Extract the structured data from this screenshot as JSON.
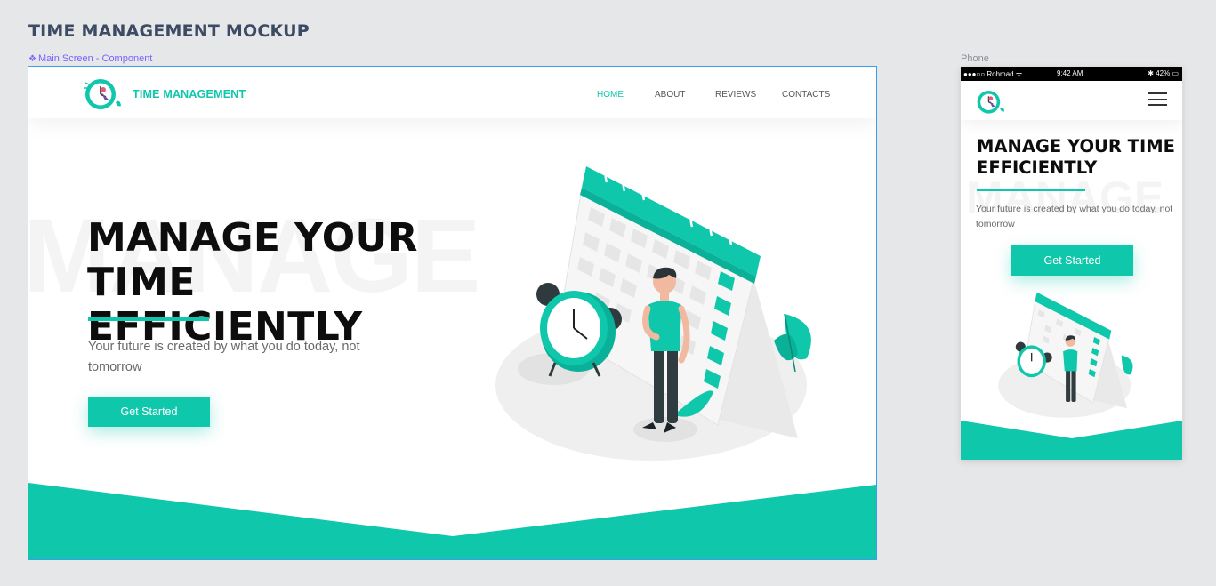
{
  "page": {
    "title": "TIME MANAGEMENT MOCKUP",
    "frame_label": "Main Screen  - Component",
    "phone_label": "Phone"
  },
  "colors": {
    "accent": "#0fc7ab",
    "frame_selection": "#3c9cf0",
    "text_dark": "#0d0d0d",
    "text_muted": "#6a6a6a"
  },
  "desktop": {
    "brand": "TIME MANAGEMENT",
    "nav": [
      {
        "label": "HOME",
        "active": true
      },
      {
        "label": "ABOUT",
        "active": false
      },
      {
        "label": "REVIEWS",
        "active": false
      },
      {
        "label": "CONTACTS",
        "active": false
      }
    ],
    "watermark": "MANAGE",
    "headline_line1": "MANAGE YOUR TIME",
    "headline_line2": "EFFICIENTLY",
    "subtitle": "Your future is created by what you do today, not tomorrow",
    "cta": "Get Started",
    "icons": {
      "logo": "clock-logo-icon",
      "illustration": "calendar-clock-person-illustration"
    }
  },
  "phone": {
    "status": {
      "carrier": "●●●○○ Rohmad ᯤ",
      "time": "9:42 AM",
      "battery": "✱ 42% ▭"
    },
    "watermark": "MANAGE",
    "headline_line1": "MANAGE YOUR TIME",
    "headline_line2": "EFFICIENTLY",
    "subtitle": "Your future is created by what you do today, not tomorrow",
    "cta": "Get Started",
    "icons": {
      "logo": "clock-logo-icon",
      "menu": "hamburger-menu-icon"
    }
  }
}
